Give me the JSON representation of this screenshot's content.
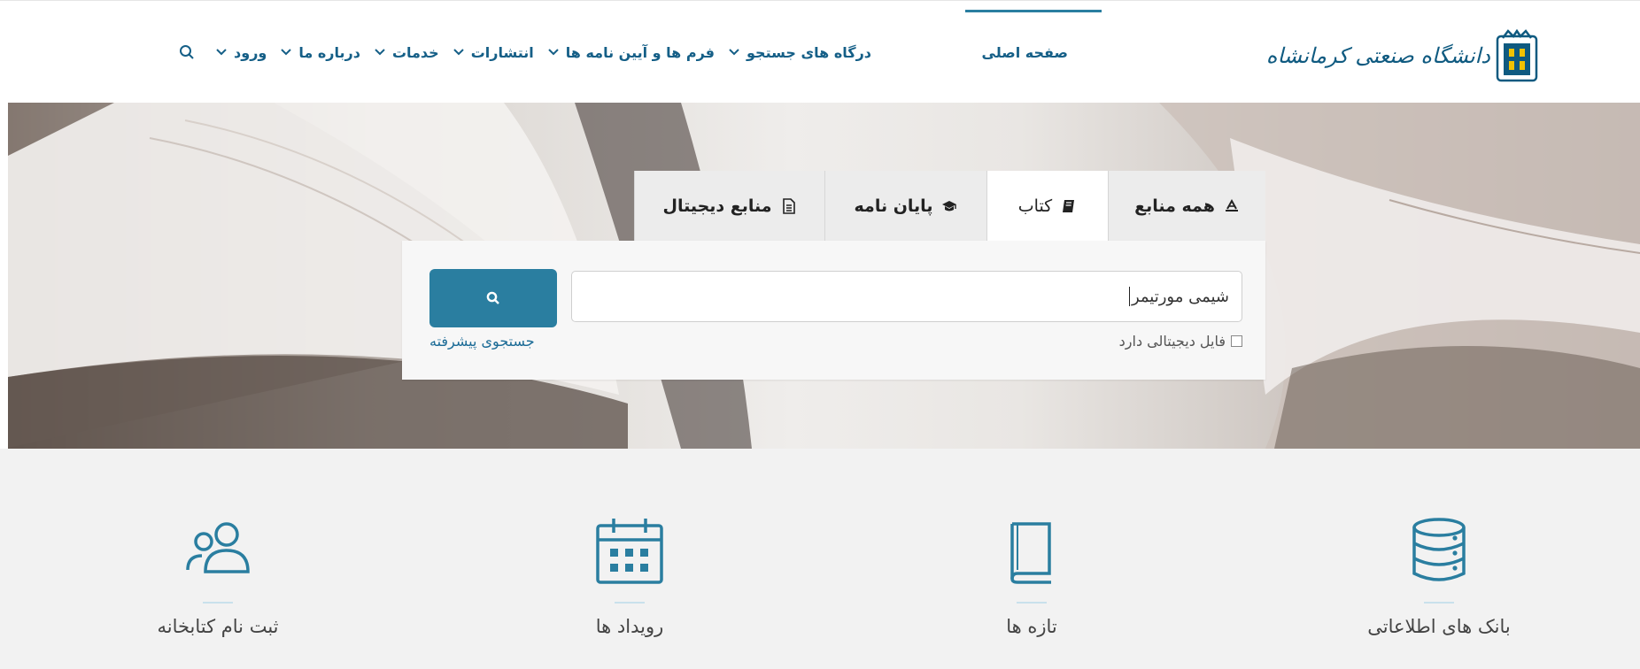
{
  "header": {
    "logo_text": "دانشگاه صنعتی کرمانشاه",
    "nav": {
      "home": "صفحه اصلی",
      "items": [
        {
          "label": "درگاه های جستجو"
        },
        {
          "label": "فرم ها و آیین نامه ها"
        },
        {
          "label": "انتشارات"
        },
        {
          "label": "خدمات"
        },
        {
          "label": "درباره ما"
        },
        {
          "label": "ورود"
        }
      ]
    }
  },
  "search": {
    "tabs": [
      {
        "label": "همه منابع",
        "icon": "all-resources-icon"
      },
      {
        "label": "کتاب",
        "icon": "book-icon"
      },
      {
        "label": "پایان نامه",
        "icon": "graduation-cap-icon"
      },
      {
        "label": "منابع دیجیتال",
        "icon": "document-icon"
      }
    ],
    "active_tab": "کتاب",
    "query": "شیمی مورتیمر",
    "advanced_label": "جستجوی پیشرفته",
    "digital_checkbox_label": "فایل دیجیتالی دارد",
    "digital_checkbox_checked": false
  },
  "features": [
    {
      "label": "بانک های اطلاعاتی",
      "icon": "database-icon"
    },
    {
      "label": "تازه ها",
      "icon": "book-icon"
    },
    {
      "label": "رویداد ها",
      "icon": "calendar-icon"
    },
    {
      "label": "ثبت نام کتابخانه",
      "icon": "users-icon"
    }
  ],
  "colors": {
    "primary": "#2a7ea0",
    "nav_text": "#155f87",
    "feature_bg": "#f2f2f2"
  }
}
